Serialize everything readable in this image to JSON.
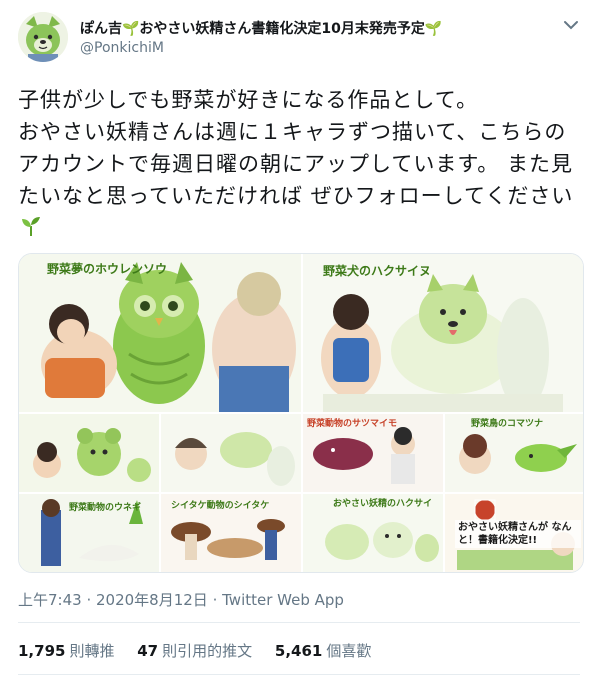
{
  "user": {
    "display_name": "ぽん吉🌱おやさい妖精さん書籍化決定10月末発売予定🌱",
    "handle": "@PonkichiM"
  },
  "tweet": {
    "text": "子供が少しでも野菜が好きになる作品として。\nおやさい妖精さんは週に１キャラずつ描いて、こちらのアカウントで毎週日曜の朝にアップしています。 また見たいなと思っていただければ ぜひフォローしてください"
  },
  "media": {
    "panel1_title": "野菜夢のホウレンソウ",
    "panel2_title": "野菜犬のハクサイヌ",
    "panel5_title": "野菜動物のサツマイモ",
    "panel6_title": "野菜鳥のコマツナ",
    "panel7_title": "野菜動物のウネギ",
    "panel8_title": "シイタケ動物のシイタケ",
    "panel9_title": "おやさい妖精のハクサイ",
    "panel10_caption": "おやさい妖精さんが なんと！書籍化決定!!"
  },
  "meta": {
    "timestamp": "上午7:43 · 2020年8月12日",
    "source": "Twitter Web App"
  },
  "stats": {
    "retweets": "1,795",
    "retweets_label": "則轉推",
    "quotes": "47",
    "quotes_label": "則引用的推文",
    "likes": "5,461",
    "likes_label": "個喜歡"
  },
  "colors": {
    "text": "#14171a",
    "secondary": "#657786",
    "sprout": "#5aa028",
    "divider": "#e6ecf0"
  },
  "icons": [
    "dog-avatar-icon",
    "sprout-icon",
    "chevron-down-icon"
  ]
}
